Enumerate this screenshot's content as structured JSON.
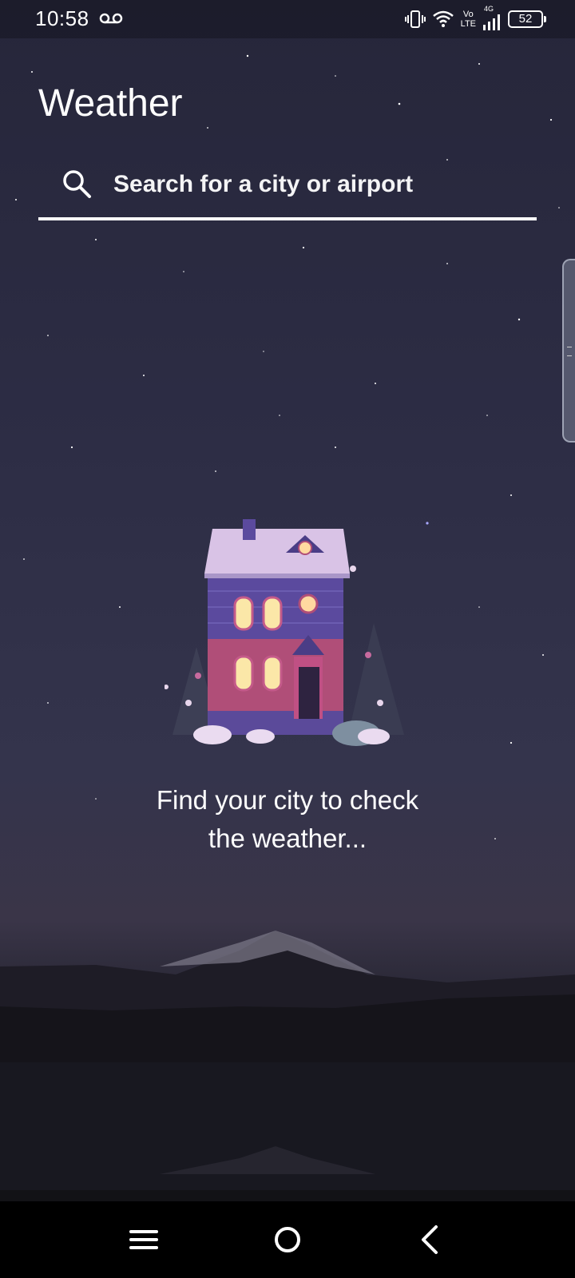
{
  "status_bar": {
    "time": "10:58",
    "voicemail_icon": "voicemail-icon",
    "vibrate_icon": "vibrate-icon",
    "wifi_icon": "wifi-icon",
    "volte_top": "Vo",
    "volte_bottom": "LTE",
    "network_type": "4G",
    "signal_icon": "signal-icon",
    "battery_level": "52"
  },
  "header": {
    "title": "Weather"
  },
  "search": {
    "placeholder": "Search for a city or airport",
    "value": ""
  },
  "empty_state": {
    "illustration": "house-illustration",
    "message": "Find your city to check\nthe weather..."
  },
  "nav_bar": {
    "menu_icon": "menu-icon",
    "home_icon": "home-icon",
    "back_icon": "back-icon"
  },
  "colors": {
    "accent": "#ffffff",
    "background_top": "#26263a",
    "background_bottom": "#0f0f14",
    "nav_bar": "#000000"
  }
}
